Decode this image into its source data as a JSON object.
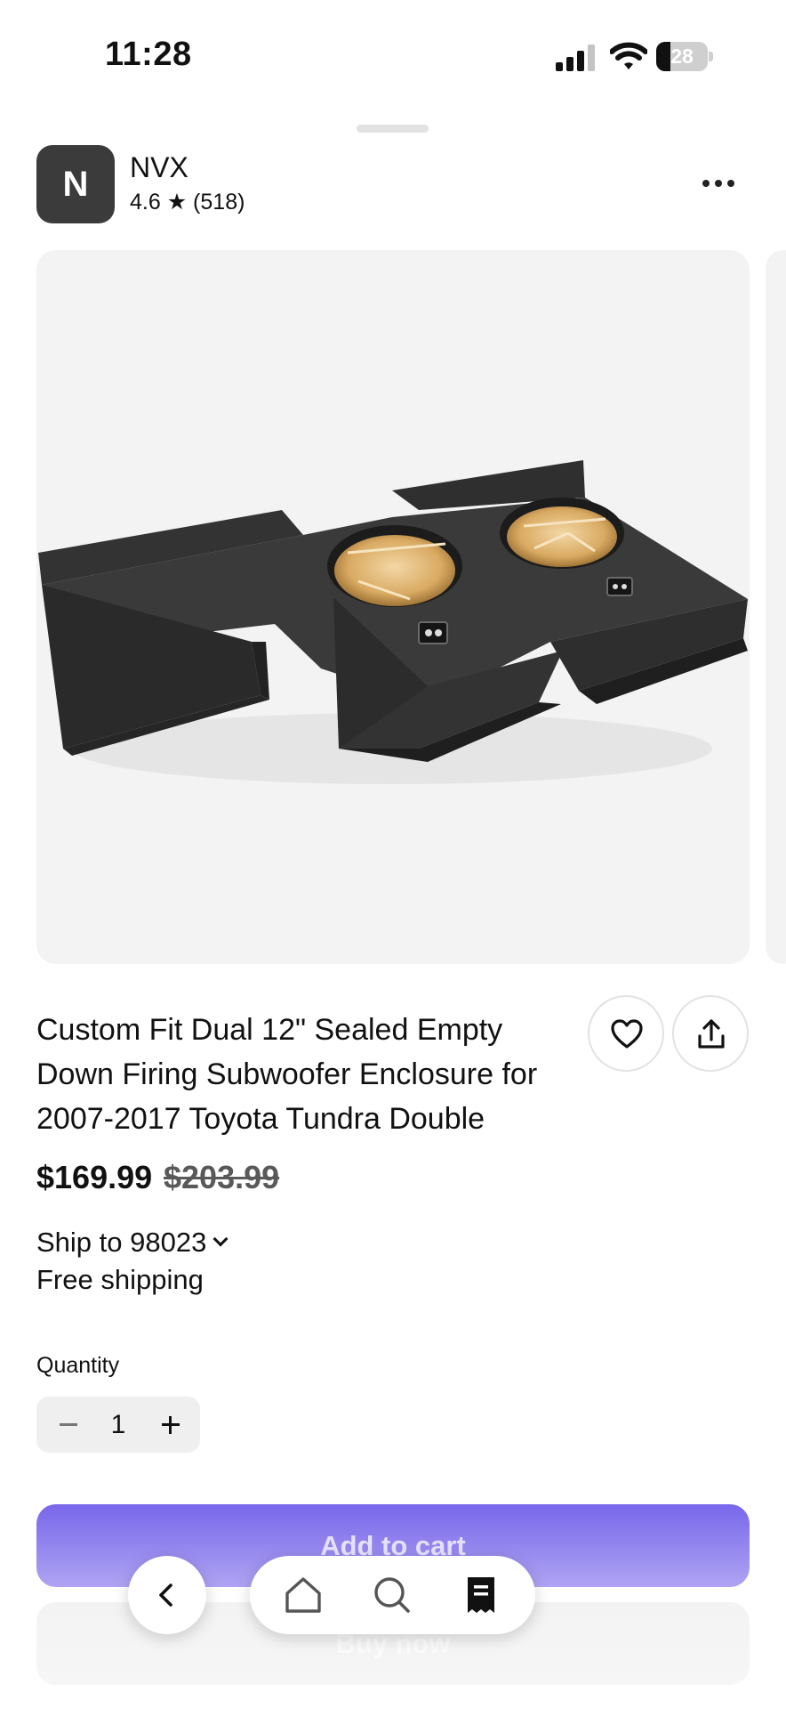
{
  "status_bar": {
    "time": "11:28",
    "battery_percent": "28",
    "battery_level": 0.28,
    "icons": [
      "cellular-signal-icon",
      "wifi-icon",
      "battery-icon"
    ]
  },
  "shop": {
    "avatar_letter": "N",
    "name": "NVX",
    "rating_text": "4.6 ★ (518)",
    "more_icon": "more-horizontal-icon"
  },
  "product": {
    "title": "Custom Fit Dual 12\" Sealed Empty Down Firing Subwoofer Enclosure for 2007-2017 Toyota Tundra Double",
    "price": "$169.99",
    "original_price": "$203.99",
    "image_icon": "subwoofer-enclosure-image",
    "actions": {
      "favorite_icon": "heart-icon",
      "share_icon": "share-icon"
    }
  },
  "shipping": {
    "ship_to": "Ship to 98023",
    "note": "Free shipping"
  },
  "quantity": {
    "label": "Quantity",
    "value": "1"
  },
  "cta": {
    "add_to_cart": "Add to cart",
    "buy_now": "Buy now"
  },
  "nav": {
    "back_icon": "chevron-left-icon",
    "tabs": [
      "home-icon",
      "search-icon",
      "receipt-icon"
    ]
  },
  "colors": {
    "accent": "#5b46e6",
    "image_bg": "#f3f3f3"
  }
}
